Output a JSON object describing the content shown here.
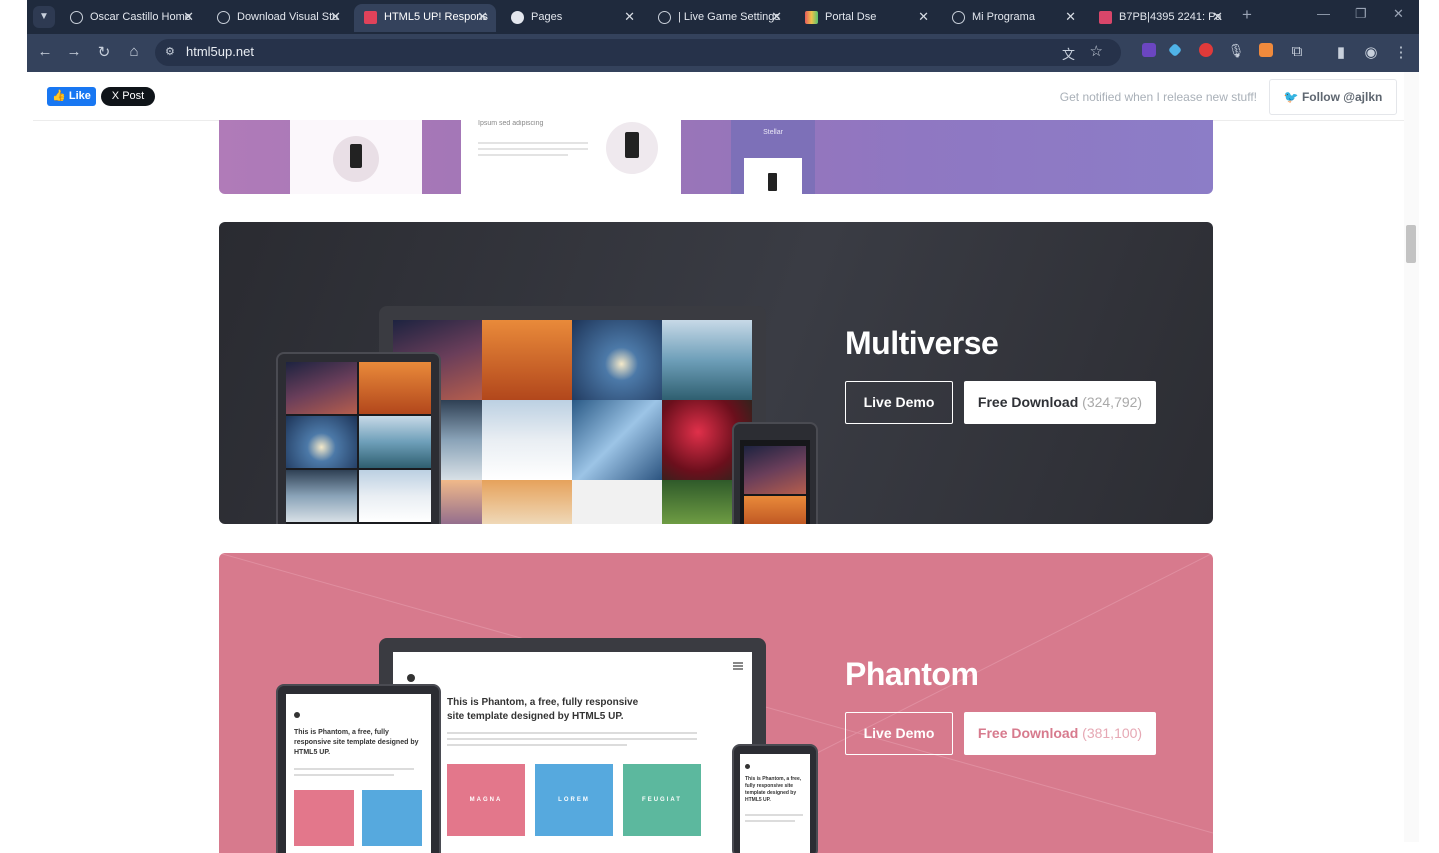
{
  "browser": {
    "tabs": [
      {
        "label": "Oscar Castillo Home",
        "active": false
      },
      {
        "label": "Download Visual Stu",
        "active": false
      },
      {
        "label": "HTML5 UP! Respons",
        "active": true
      },
      {
        "label": "Pages",
        "active": false
      },
      {
        "label": "| Live Game Settings",
        "active": false
      },
      {
        "label": "Portal Dse",
        "active": false
      },
      {
        "label": "Mi Programa",
        "active": false
      },
      {
        "label": "B7PB|4395 2241: Pa",
        "active": false
      }
    ],
    "new_tab_symbol": "+",
    "url": "html5up.net"
  },
  "topbar": {
    "like_label": "Like",
    "post_label": "X Post",
    "notify_text": "Get notified when I release new stuff!",
    "follow_label": "Follow @ajlkn"
  },
  "templates": [
    {
      "name": "Multiverse",
      "live_demo_label": "Live Demo",
      "download_label": "Free Download",
      "download_count": "(324,792)",
      "accent": "#2f3136"
    },
    {
      "name": "Phantom",
      "live_demo_label": "Live Demo",
      "download_label": "Free Download",
      "download_count": "(381,100)",
      "accent": "#d77a8d",
      "preview_heading": "This is Phantom, a free, fully responsive site template designed by HTML5 UP.",
      "preview_tiles": [
        "MAGNA",
        "LOREM",
        "FEUGIAT"
      ]
    }
  ],
  "stellar_preview": {
    "caption": "Ipsum sed adipiscing",
    "brand": "Stellar"
  }
}
